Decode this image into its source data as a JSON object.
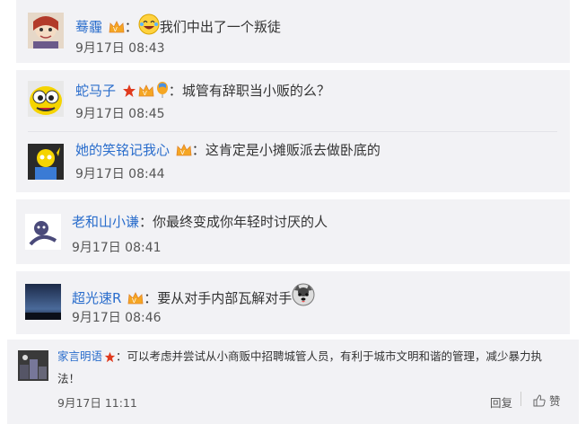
{
  "comments": [
    {
      "user": "蓦霾",
      "separator": "：",
      "text": "我们中出了一个叛徒",
      "time": "9月17日 08:43"
    },
    {
      "user": "蛇马子",
      "separator": "：",
      "text": "城管有辞职当小贩的么？",
      "time": "9月17日 08:45"
    },
    {
      "user": "她的笑铭记我心",
      "separator": "：",
      "text": "这肯定是小摊贩派去做卧底的",
      "time": "9月17日 08:44"
    },
    {
      "user": "老和山小谦",
      "separator": "：",
      "text": "你最终变成你年轻时讨厌的人",
      "time": "9月17日 08:41"
    },
    {
      "user": "超光速R",
      "separator": "：",
      "text": "要从对手内部瓦解对手",
      "time": "9月17日 08:46"
    },
    {
      "user": "家言明语",
      "separator": "：",
      "text_line1": "可以考虑并尝试从小商贩中招聘城管人员，有利于城市文明和谐的管理，减少暴力执",
      "text_line2": "法！",
      "time": "9月17日 11:11",
      "reply_label": "回复",
      "like_label": "赞"
    }
  ],
  "colors": {
    "username": "#2a6dcc",
    "card_bg": "#f2f2f5",
    "text": "#333333"
  }
}
